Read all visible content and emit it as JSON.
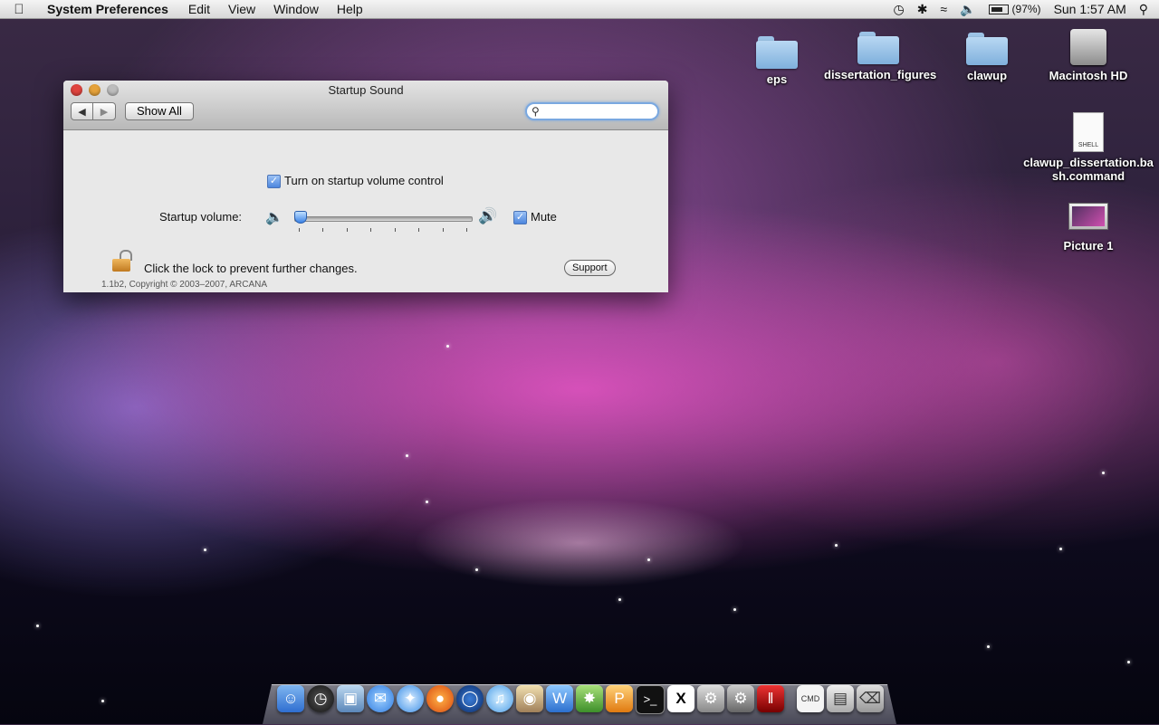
{
  "menubar": {
    "app_name": "System Preferences",
    "items": [
      "Edit",
      "View",
      "Window",
      "Help"
    ],
    "battery_percent": "(97%)",
    "clock": "Sun 1:57 AM"
  },
  "window": {
    "title": "Startup Sound",
    "show_all_label": "Show All",
    "search_value": "",
    "toggle_label": "Turn on startup volume control",
    "toggle_checked": true,
    "volume_label": "Startup volume:",
    "volume_level": 0.0,
    "mute_label": "Mute",
    "mute_checked": true,
    "lock_text": "Click the lock to prevent further changes.",
    "support_label": "Support",
    "copyright": "1.1b2, Copyright © 2003–2007, ARCANA"
  },
  "desktop": {
    "eps": "eps",
    "dissertation_figures": "dissertation_figures",
    "clawup": "clawup",
    "macintosh_hd": "Macintosh HD",
    "shell_tag": "SHELL",
    "clawup_command": "clawup_dissertation.bash.command",
    "picture1": "Picture 1"
  },
  "dock": {
    "icons": [
      "finder-icon",
      "dashboard-icon",
      "preview-icon",
      "ichat-icon",
      "safari-icon",
      "firefox-icon",
      "google-earth-icon",
      "itunes-icon",
      "gimp-icon",
      "word-icon",
      "network-icon",
      "pages-icon",
      "terminal-icon",
      "x11-icon",
      "disk-utility-icon",
      "system-preferences-icon",
      "parallels-icon",
      "document-icon",
      "window-icon",
      "trash-icon"
    ]
  }
}
